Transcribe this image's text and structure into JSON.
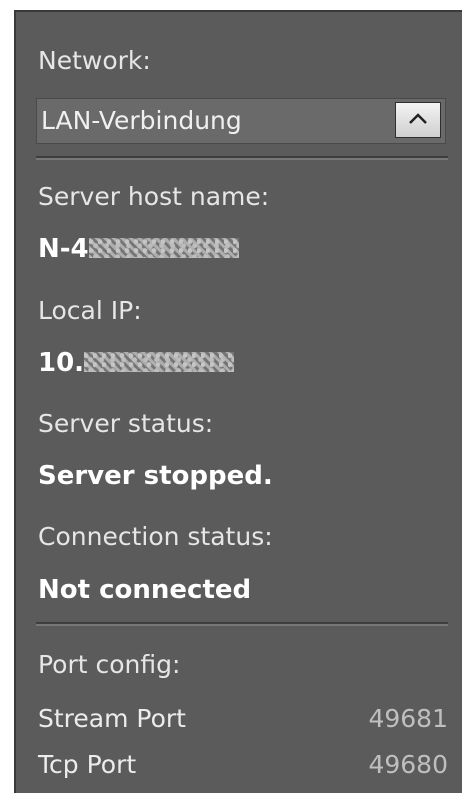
{
  "network": {
    "label": "Network:",
    "selected": "LAN-Verbindung",
    "toggle_icon": "chevron-up-icon"
  },
  "server_host": {
    "label": "Server host name:",
    "value_prefix": "N-4"
  },
  "local_ip": {
    "label": "Local IP:",
    "value_prefix": "10."
  },
  "server_status": {
    "label": "Server status:",
    "value": "Server stopped."
  },
  "connection_status": {
    "label": "Connection status:",
    "value": "Not connected"
  },
  "ports": {
    "label": "Port config:",
    "items": [
      {
        "name": "Stream Port",
        "value": "49681"
      },
      {
        "name": "Tcp Port",
        "value": "49680"
      }
    ]
  },
  "colors": {
    "panel_bg": "#5b5b5b",
    "text": "#e6e6e6"
  }
}
